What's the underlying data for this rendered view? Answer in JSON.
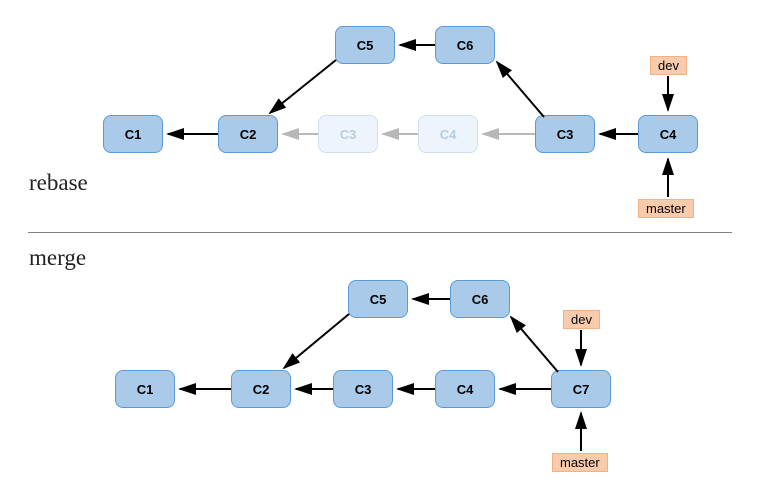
{
  "labels": {
    "rebase": "rebase",
    "merge": "merge"
  },
  "branches": {
    "dev": "dev",
    "master": "master"
  },
  "rebase": {
    "c1": "C1",
    "c2": "C2",
    "c3_ghost": "C3",
    "c4_ghost": "C4",
    "c5": "C5",
    "c6": "C6",
    "c3": "C3",
    "c4": "C4"
  },
  "merge": {
    "c1": "C1",
    "c2": "C2",
    "c3": "C3",
    "c4": "C4",
    "c5": "C5",
    "c6": "C6",
    "c7": "C7"
  }
}
